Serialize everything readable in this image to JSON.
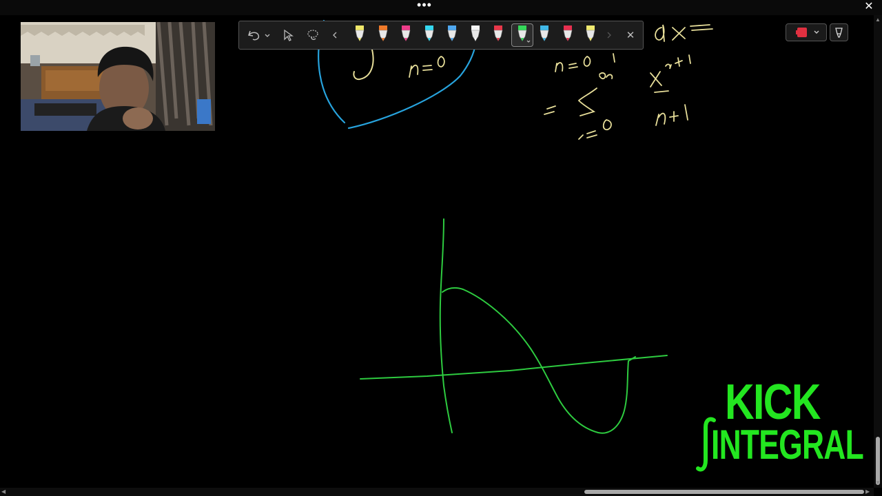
{
  "titlebar": {
    "menu_glyph": "•••",
    "close_glyph": "✕"
  },
  "toolbar": {
    "undo_icon": "undo-icon",
    "select_icon": "select-cursor-icon",
    "lasso_icon": "lasso-icon",
    "prev_icon": "chevron-left-icon",
    "next_icon": "chevron-right-icon",
    "close_glyph": "✕",
    "pens": [
      {
        "color": "#f0e86a",
        "name": "yellow"
      },
      {
        "color": "#f07a2a",
        "name": "orange"
      },
      {
        "color": "#ee3d8a",
        "name": "pink"
      },
      {
        "color": "#35d8f0",
        "name": "cyan-highlighter"
      },
      {
        "color": "#4fa8f0",
        "name": "blue-highlighter"
      },
      {
        "color": "#f4f4f4",
        "name": "white"
      },
      {
        "color": "#e8384a",
        "name": "red"
      },
      {
        "color": "#35d95a",
        "name": "green",
        "selected": true
      },
      {
        "color": "#40b8e8",
        "name": "light-blue"
      },
      {
        "color": "#e83050",
        "name": "crimson"
      },
      {
        "color": "#f0ea70",
        "name": "pale-yellow"
      }
    ]
  },
  "colors": {
    "ink_green": "#2ecc40",
    "ink_blue": "#27a3dd",
    "ink_yellow": "#e8df9a",
    "logo_green": "#23e620",
    "background": "#000000"
  },
  "logo": {
    "line1": "KICK",
    "line2": "INTEGRAL"
  }
}
